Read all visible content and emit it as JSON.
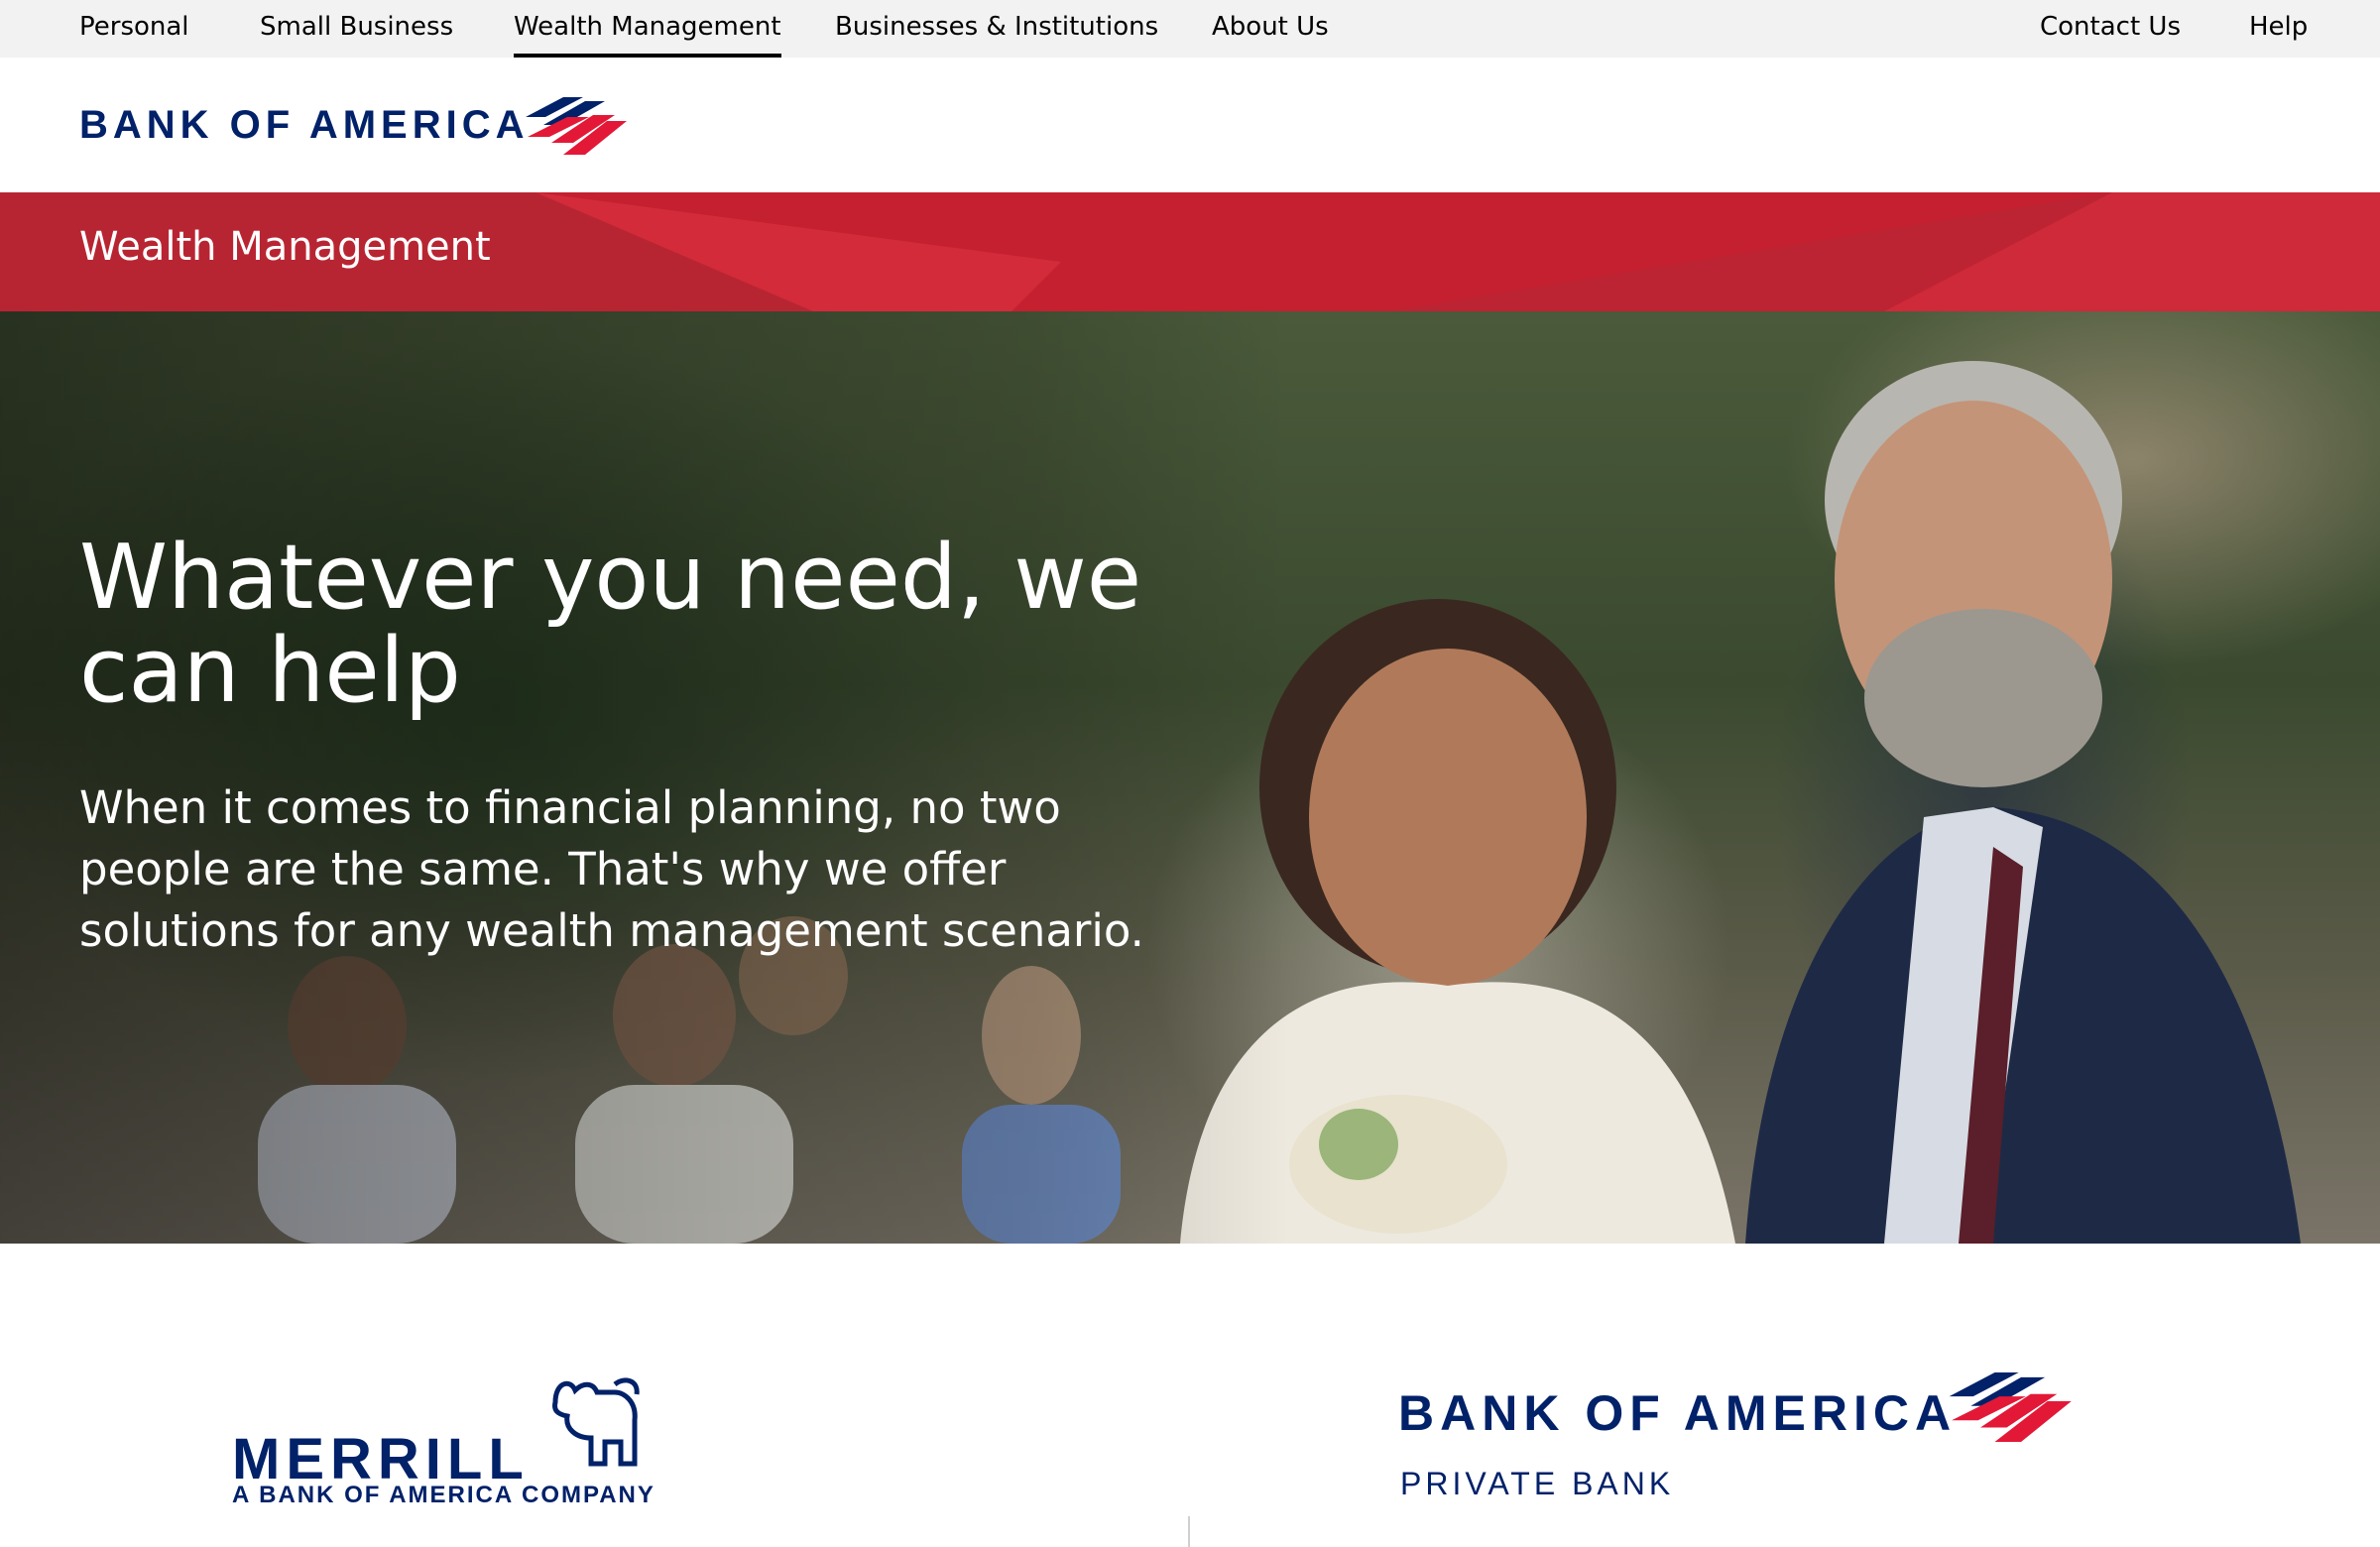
{
  "topnav": {
    "items": [
      {
        "label": "Personal"
      },
      {
        "label": "Small Business"
      },
      {
        "label": "Wealth Management",
        "active": true
      },
      {
        "label": "Businesses & Institutions"
      },
      {
        "label": "About Us"
      }
    ],
    "right": [
      {
        "label": "Contact Us"
      },
      {
        "label": "Help"
      }
    ]
  },
  "header": {
    "logo_text": "BANK OF AMERICA",
    "logo_flag_icon": "bank-of-america-flag-icon"
  },
  "section_band": {
    "title": "Wealth Management"
  },
  "hero": {
    "heading": "Whatever you need, we can help",
    "body": "When it comes to financial planning, no two people are the same. That's why we offer solutions for any wealth management scenario."
  },
  "brands": {
    "merrill": {
      "name": "MERRILL",
      "tagline": "A BANK OF AMERICA COMPANY",
      "icon": "merrill-bull-icon"
    },
    "private_bank": {
      "name": "BANK OF AMERICA",
      "tagline": "PRIVATE BANK",
      "icon": "bank-of-america-flag-icon"
    }
  },
  "colors": {
    "brand_navy": "#012169",
    "brand_red": "#c4202f",
    "nav_bg": "#f2f2f2"
  }
}
